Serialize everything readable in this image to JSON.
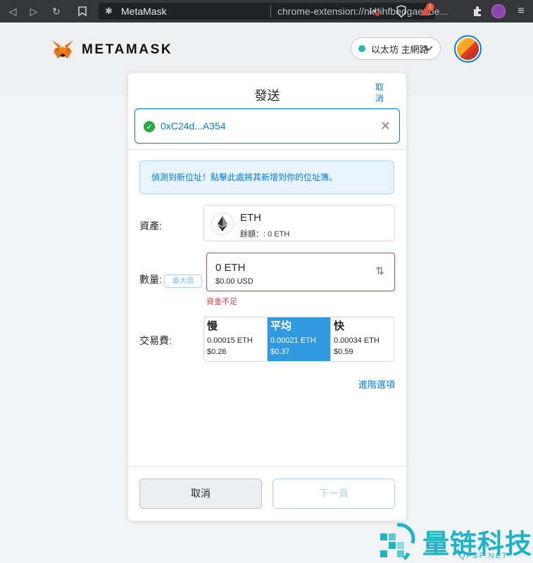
{
  "browser": {
    "tab_title": "MetaMask",
    "url": "chrome-extension://nkbihfbeogaeaoe...",
    "icons": [
      "back-icon",
      "forward-icon",
      "reload-icon",
      "bookmark-icon",
      "extension-icon",
      "cast-icon",
      "brave-shield-icon",
      "brave-rewards-icon",
      "puzzle-icon",
      "profile-icon",
      "menu-icon"
    ],
    "rewards_badge": "1"
  },
  "header": {
    "brand": "METAMASK",
    "network_label": "以太坊 主網路",
    "network_dot_color": "#29b6af"
  },
  "send": {
    "title": "發送",
    "cancel_link": "取消",
    "recipient": "0xC24d...A354",
    "notice": "偵測到新位址！點擊此處將其新增到你的位址簿。",
    "asset_label": "資產:",
    "asset_symbol": "ETH",
    "asset_balance": "餘額：: 0 ETH",
    "amount_label": "數量:",
    "max_button": "最大值",
    "amount_value": "0  ETH",
    "amount_usd": "$0.00 USD",
    "error": "資金不足",
    "fee_label": "交易費:",
    "fees": [
      {
        "name": "慢",
        "eth": "0.00015 ETH",
        "usd": "$0.26",
        "selected": false
      },
      {
        "name": "平均",
        "eth": "0.00021 ETH",
        "usd": "$0.37",
        "selected": true
      },
      {
        "name": "快",
        "eth": "0.00034 ETH",
        "usd": "$0.59",
        "selected": false
      }
    ],
    "advanced": "進階選項",
    "footer_cancel": "取消",
    "footer_next": "下一頁"
  },
  "watermark": {
    "text": "量链科技",
    "sub": "QFSP.NET"
  },
  "colors": {
    "accent": "#037dd6",
    "error": "#d73a49",
    "selected_fee": "#2f9ae0"
  }
}
